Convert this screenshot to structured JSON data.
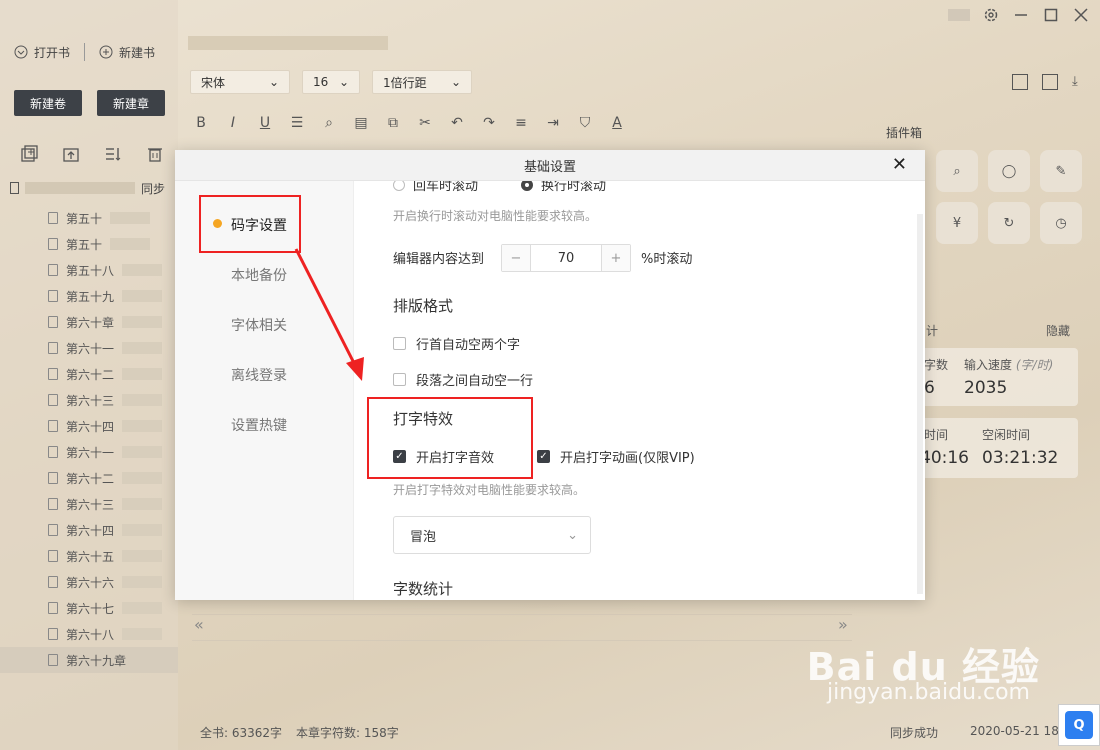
{
  "window": {
    "controls": [
      "settings-icon",
      "minimize-icon",
      "maximize-icon",
      "close-icon"
    ]
  },
  "left": {
    "open_book": "打开书",
    "new_book": "新建书",
    "new_volume": "新建卷",
    "new_chapter": "新建章",
    "book_sync": "同步",
    "chapters": [
      "第五十",
      "第五十",
      "第五十八",
      "第五十九",
      "第六十章",
      "第六十一",
      "第六十二",
      "第六十三",
      "第六十四",
      "第六十一",
      "第六十二",
      "第六十三",
      "第六十四",
      "第六十五",
      "第六十六",
      "第六十七",
      "第六十八",
      "第六十九章"
    ]
  },
  "toolbar": {
    "font": "宋体",
    "size": "16",
    "line_spacing": "1倍行距"
  },
  "right": {
    "plugins_label": "插件箱",
    "stats_hidden": "隐藏",
    "stat_partial_1": "计",
    "word_label_partial": "字数",
    "speed_label": "输入速度",
    "speed_unit": "(字/时)",
    "word_value_partial": "6",
    "speed_value": "2035",
    "time_label_partial": "时间",
    "idle_label": "空闲时间",
    "time_value_partial": "40:16",
    "idle_value": "03:21:32"
  },
  "statusbar": {
    "total": "全书: 63362字",
    "chapter_count": "本章字符数: 158字",
    "sync": "同步成功",
    "date": "2020-05-21 18:"
  },
  "modal": {
    "title": "基础设置",
    "close": "✕",
    "nav": [
      "码字设置",
      "本地备份",
      "字体相关",
      "离线登录",
      "设置热键"
    ],
    "scroll_option_1": "回车时滚动",
    "scroll_option_2": "换行时滚动",
    "scroll_hint": "开启换行时滚动对电脑性能要求较高。",
    "editor_reach_label": "编辑器内容达到",
    "editor_reach_value": "70",
    "editor_reach_suffix": "%时滚动",
    "typeset_title": "排版格式",
    "typeset_opt1": "行首自动空两个字",
    "typeset_opt2": "段落之间自动空一行",
    "effect_title": "打字特效",
    "effect_opt1": "开启打字音效",
    "effect_opt2": "开启打字动画(仅限VIP)",
    "effect_hint": "开启打字特效对电脑性能要求较高。",
    "effect_select": "冒泡",
    "wordcount_title": "字数统计"
  },
  "watermark": {
    "text": "Bai du 经验",
    "url": "jingyan.baidu.com"
  }
}
